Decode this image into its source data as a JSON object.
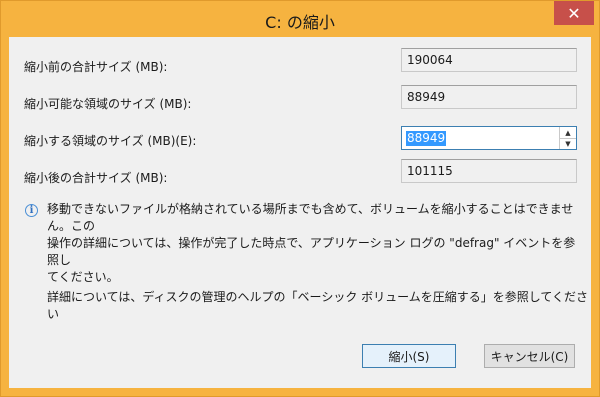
{
  "window": {
    "title": "C: の縮小",
    "close_glyph": "✕"
  },
  "fields": [
    {
      "label": "縮小前の合計サイズ (MB):",
      "value": "190064"
    },
    {
      "label": "縮小可能な領域のサイズ (MB):",
      "value": "88949"
    },
    {
      "label": "縮小する領域のサイズ (MB)(E):",
      "value": "88949"
    },
    {
      "label": "縮小後の合計サイズ (MB):",
      "value": "101115"
    }
  ],
  "info": {
    "icon": "info-icon",
    "icon_glyph": "i",
    "line1": "移動できないファイルが格納されている場所までも含めて、ボリュームを縮小することはできません。この",
    "line2": "操作の詳細については、操作が完了した時点で、アプリケーション ログの \"defrag\" イベントを参照し",
    "line3": "てください。"
  },
  "help_text": "詳細については、ディスクの管理のヘルプの「ベーシック ボリュームを圧縮する」を参照してください",
  "buttons": {
    "shrink": "縮小(S)",
    "cancel": "キャンセル(C)"
  },
  "colors": {
    "titlebar": "#f6b340",
    "close": "#c7504a",
    "client": "#f0f0f0",
    "focus_border": "#3c7fb1",
    "selection": "#3399ff"
  }
}
